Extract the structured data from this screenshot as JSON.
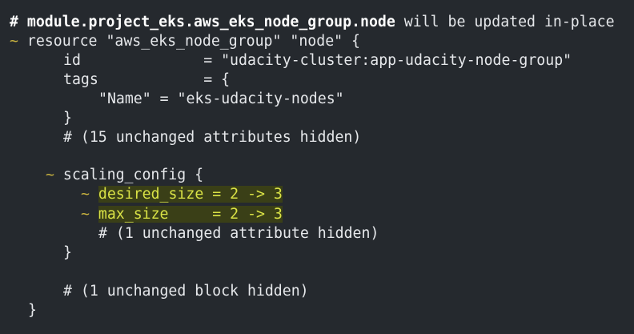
{
  "terminal": {
    "lines": [
      {
        "header_prefix": "# ",
        "header_bold": "module.project_eks.aws_eks_node_group.node",
        "header_rest": " will be updated in-place"
      },
      {
        "tilde": "~",
        "text": " resource \"aws_eks_node_group\" \"node\" {"
      },
      {
        "text": "id              = \"udacity-cluster:app-udacity-node-group\""
      },
      {
        "text": "tags            = {"
      },
      {
        "text": "\"Name\" = \"eks-udacity-nodes\""
      },
      {
        "text": "}"
      },
      {
        "text": "# (15 unchanged attributes hidden)"
      },
      {
        "tilde": "~",
        "text": " scaling_config {"
      },
      {
        "tilde": "~",
        "highlight": "desired_size = 2 -> 3"
      },
      {
        "tilde": "~",
        "highlight": "max_size     = 2 -> 3"
      },
      {
        "text": "# (1 unchanged attribute hidden)"
      },
      {
        "text": "}"
      },
      {
        "text": "# (1 unchanged block hidden)"
      },
      {
        "text": "}"
      }
    ]
  },
  "colors": {
    "background": "#25292e",
    "text": "#e6e8eb",
    "tilde": "#c8b23f",
    "highlight_bg": "#3a3f17",
    "highlight_text": "#d9e246"
  }
}
